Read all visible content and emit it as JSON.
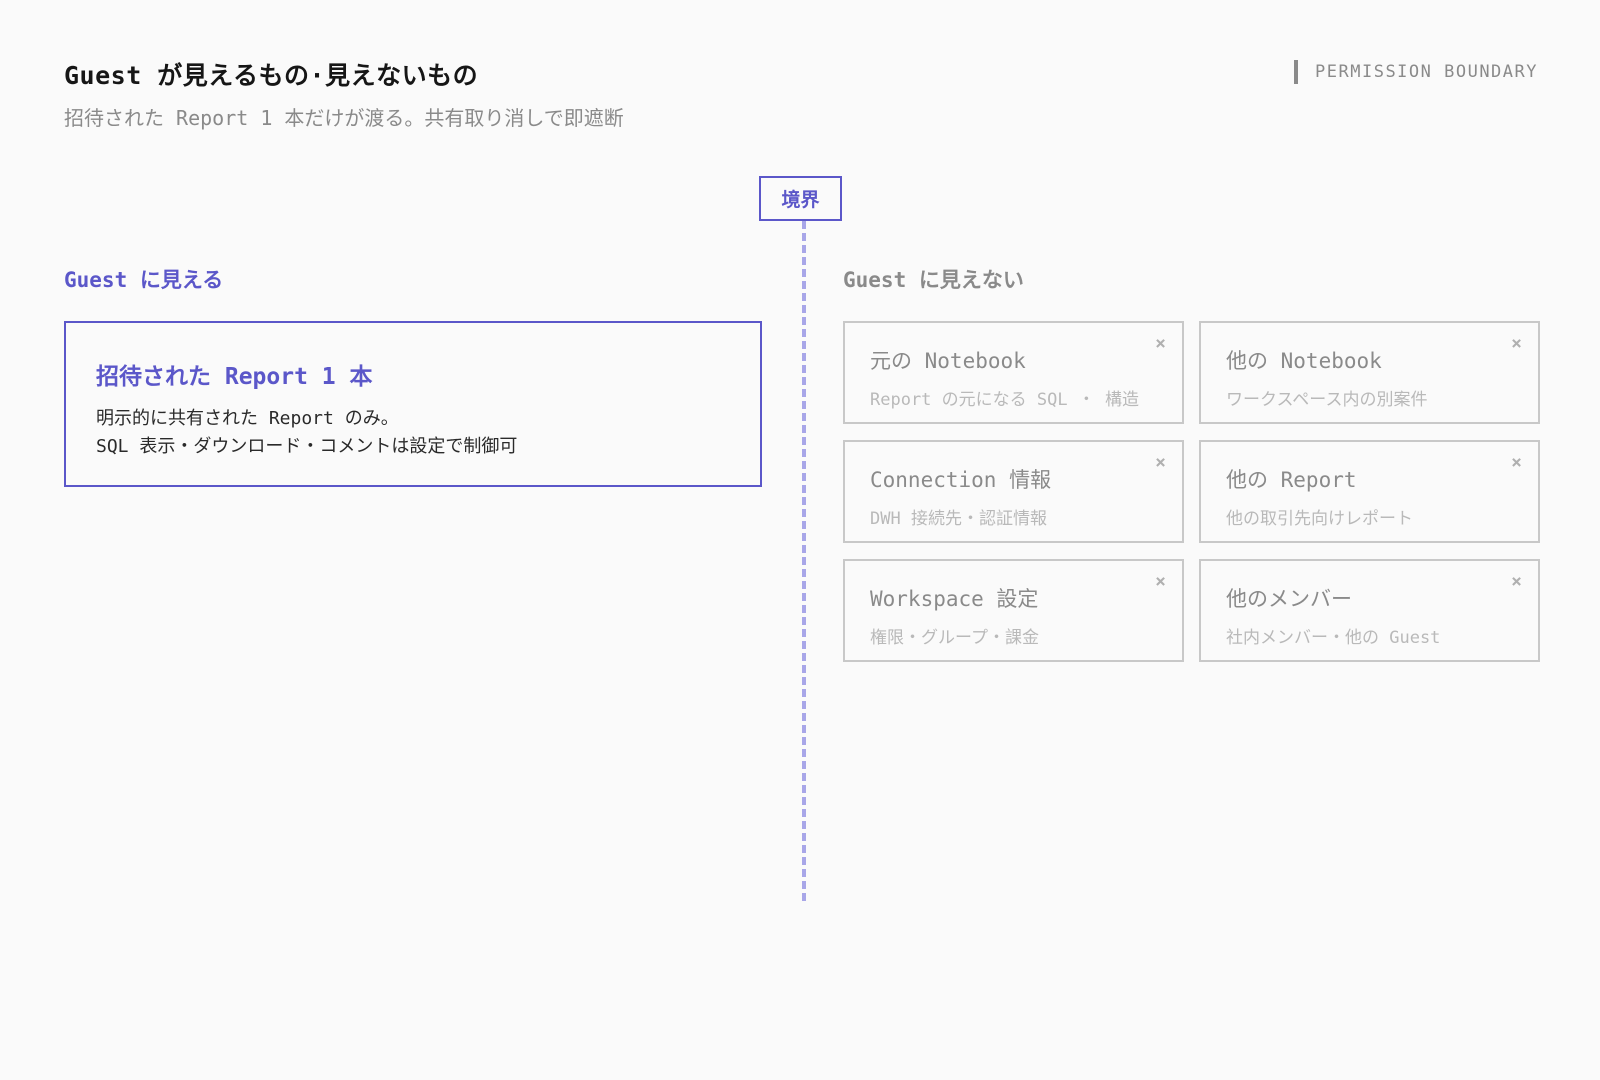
{
  "header": {
    "title": "Guest が見えるもの·見えないもの",
    "subtitle": "招待された Report 1 本だけが渡る。共有取り消しで即遮断",
    "tag": "PERMISSION BOUNDARY"
  },
  "boundary": {
    "label": "境界"
  },
  "visible": {
    "heading": "Guest に見える",
    "card": {
      "title": "招待された Report 1 本",
      "lines": [
        "明示的に共有された Report のみ。",
        "SQL 表示・ダウンロード・コメントは設定で制御可"
      ]
    }
  },
  "hidden": {
    "heading": "Guest に見えない",
    "close_glyph": "×",
    "items": [
      {
        "title": "元の Notebook",
        "subtitle": "Report の元になる SQL ・ 構造"
      },
      {
        "title": "他の Notebook",
        "subtitle": "ワークスペース内の別案件"
      },
      {
        "title": "Connection 情報",
        "subtitle": "DWH 接続先・認証情報"
      },
      {
        "title": "他の Report",
        "subtitle": "他の取引先向けレポート"
      },
      {
        "title": "Workspace 設定",
        "subtitle": "権限・グループ・課金"
      },
      {
        "title": "他のメンバー",
        "subtitle": "社内メンバー・他の Guest"
      }
    ]
  }
}
